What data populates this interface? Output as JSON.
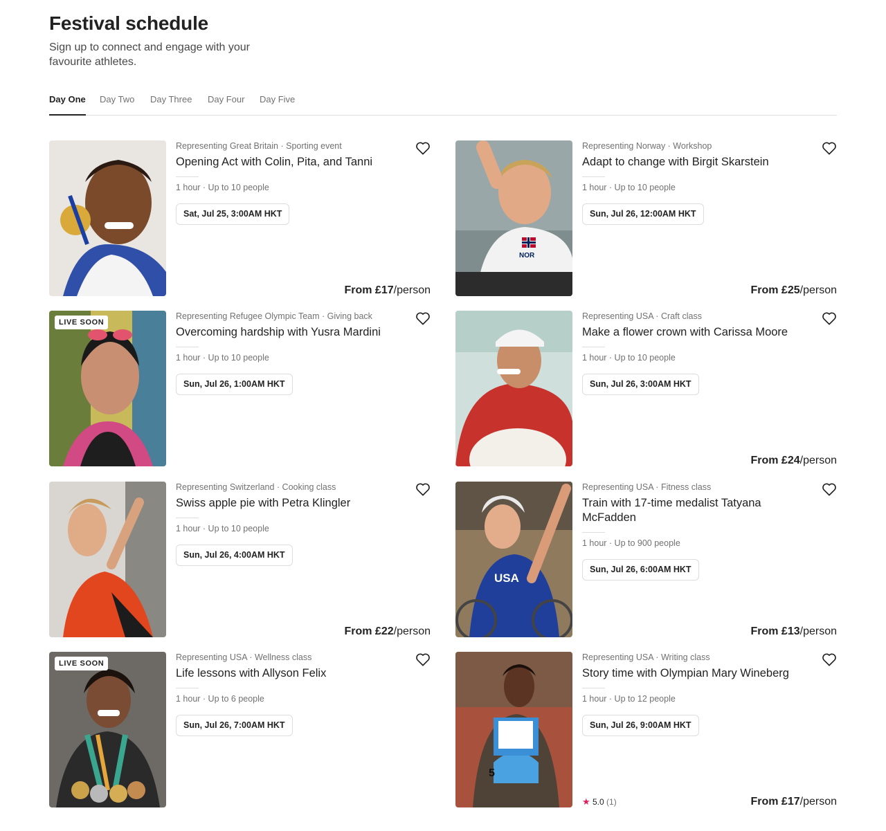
{
  "page": {
    "title": "Festival schedule",
    "subtitle": "Sign up to connect and engage with your favourite athletes."
  },
  "tabs": [
    "Day One",
    "Day Two",
    "Day Three",
    "Day Four",
    "Day Five"
  ],
  "active_tab": "Day One",
  "colors": {
    "text": "#222222",
    "muted": "#717171",
    "border": "#dddddd",
    "star": "#e31c5f"
  },
  "cards": [
    {
      "meta": "Representing Great Britain · Sporting event",
      "title": "Opening Act with Colin, Pita, and Tanni",
      "details": "1 hour · Up to 10 people",
      "date": "Sat, Jul 25, 3:00AM HKT",
      "price_from": "From £17",
      "price_unit": "/person",
      "badge": "",
      "icon": "heart-icon"
    },
    {
      "meta": "Representing Norway · Workshop",
      "title": "Adapt to change with Birgit Skarstein",
      "details": "1 hour · Up to 10 people",
      "date": "Sun, Jul 26, 12:00AM HKT",
      "price_from": "From £25",
      "price_unit": "/person",
      "badge": "",
      "icon": "heart-icon"
    },
    {
      "meta": "Representing Refugee Olympic Team · Giving back",
      "title": "Overcoming hardship with Yusra Mardini",
      "details": "1 hour · Up to 10 people",
      "date": "Sun, Jul 26, 1:00AM HKT",
      "price_from": "",
      "price_unit": "",
      "badge": "LIVE SOON",
      "icon": "heart-icon"
    },
    {
      "meta": "Representing USA · Craft class",
      "title": "Make a flower crown with Carissa Moore",
      "details": "1 hour · Up to 10 people",
      "date": "Sun, Jul 26, 3:00AM HKT",
      "price_from": "From £24",
      "price_unit": "/person",
      "badge": "",
      "icon": "heart-icon"
    },
    {
      "meta": "Representing Switzerland · Cooking class",
      "title": "Swiss apple pie with Petra Klingler",
      "details": "1 hour · Up to 10 people",
      "date": "Sun, Jul 26, 4:00AM HKT",
      "price_from": "From £22",
      "price_unit": "/person",
      "badge": "",
      "icon": "heart-icon"
    },
    {
      "meta": "Representing USA · Fitness class",
      "title": "Train with 17-time medalist Tatyana McFadden",
      "details": "1 hour · Up to 900 people",
      "date": "Sun, Jul 26, 6:00AM HKT",
      "price_from": "From £13",
      "price_unit": "/person",
      "badge": "",
      "icon": "heart-icon"
    },
    {
      "meta": "Representing USA · Wellness class",
      "title": "Life lessons with Allyson Felix",
      "details": "1 hour · Up to 6 people",
      "date": "Sun, Jul 26, 7:00AM HKT",
      "price_from": "",
      "price_unit": "",
      "badge": "LIVE SOON",
      "icon": "heart-icon"
    },
    {
      "meta": "Representing USA · Writing class",
      "title": "Story time with Olympian Mary Wineberg",
      "details": "1 hour · Up to 12 people",
      "date": "Sun, Jul 26, 9:00AM HKT",
      "price_from": "From £17",
      "price_unit": "/person",
      "badge": "",
      "icon": "heart-icon",
      "rating": "5.0",
      "rating_count": "(1)"
    }
  ],
  "photo_text": {
    "nor": "NOR",
    "usa": "USA",
    "bib": "5"
  }
}
